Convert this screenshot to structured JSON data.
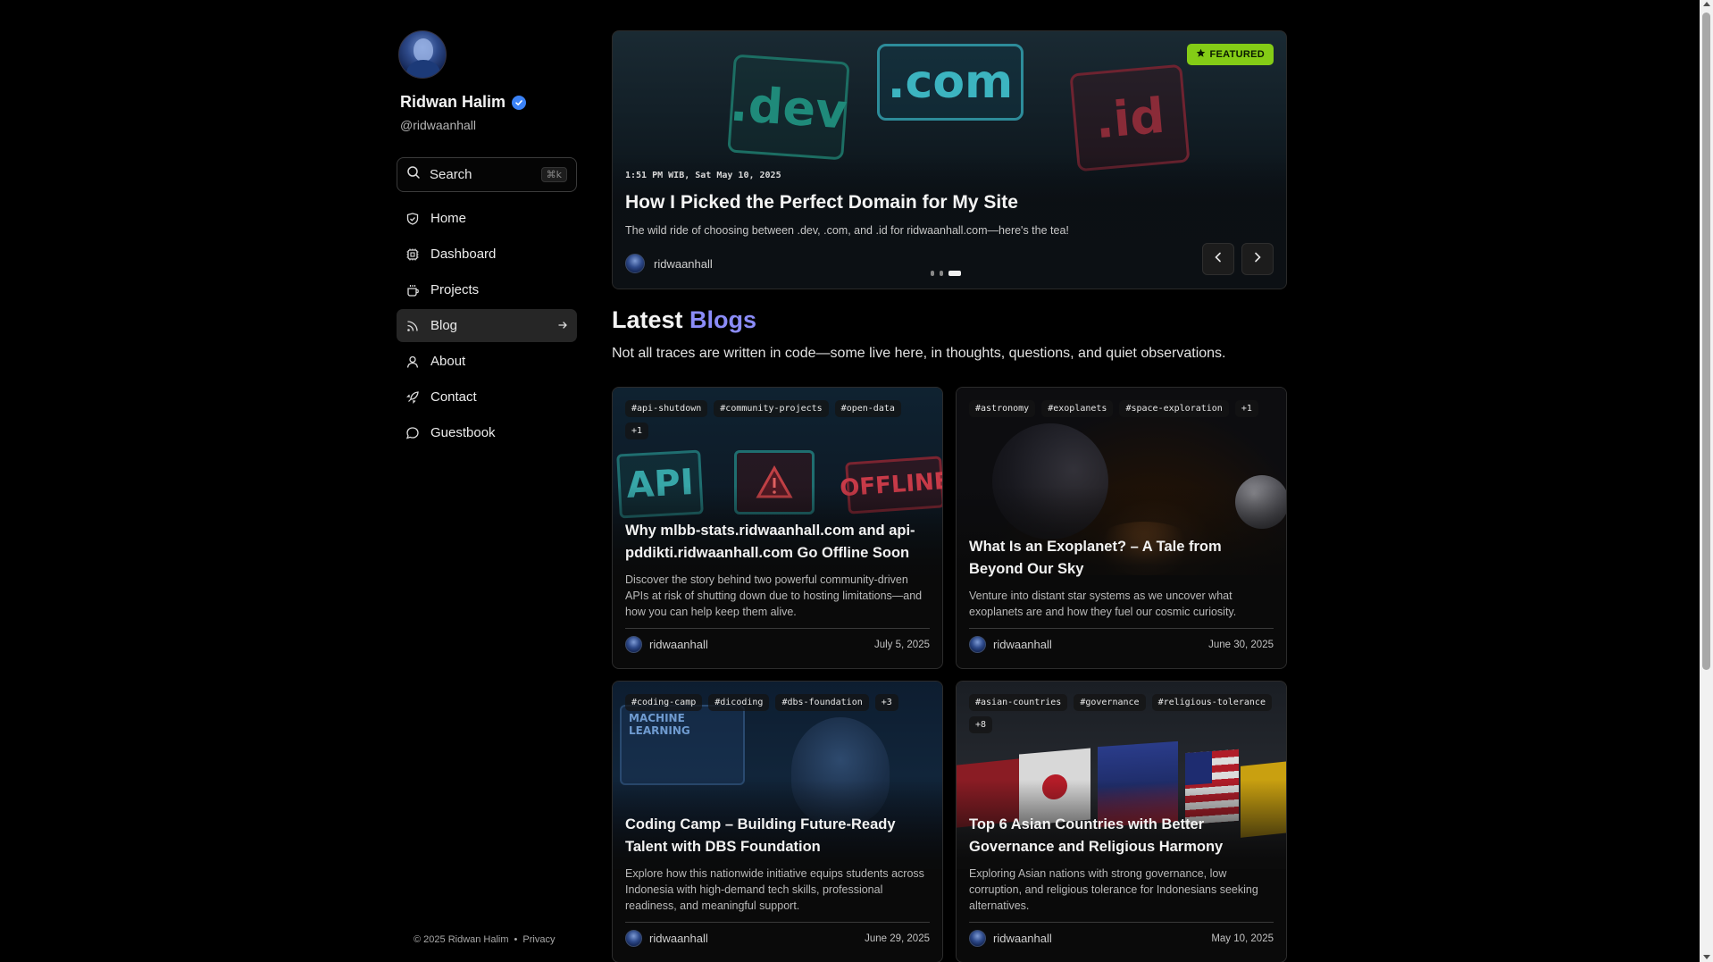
{
  "profile": {
    "name": "Ridwan Halim",
    "handle": "@ridwaanhall"
  },
  "search": {
    "label": "Search",
    "shortcut": "⌘k"
  },
  "nav": {
    "items": [
      {
        "label": "Home",
        "icon": "home-icon"
      },
      {
        "label": "Dashboard",
        "icon": "dashboard-icon"
      },
      {
        "label": "Projects",
        "icon": "projects-icon"
      },
      {
        "label": "Blog",
        "icon": "rss-icon",
        "active": true
      },
      {
        "label": "About",
        "icon": "user-icon"
      },
      {
        "label": "Contact",
        "icon": "rocket-icon"
      },
      {
        "label": "Guestbook",
        "icon": "chat-icon"
      }
    ]
  },
  "footer": {
    "copyright": "© 2025 Ridwan Halim",
    "separator": "•",
    "privacy": "Privacy"
  },
  "hero": {
    "badge": "FEATURED",
    "image_text": [
      ".dev",
      ".com",
      ".id"
    ],
    "date": "1:51 PM WIB, Sat May 10, 2025",
    "title": "How I Picked the Perfect Domain for My Site",
    "description": "The wild ride of choosing between .dev, .com, and .id for ridwaanhall.com—here's the tea!",
    "author": "ridwaanhall",
    "slide_count": 3,
    "active_slide": 3
  },
  "section": {
    "title_plain": "Latest",
    "title_accent": "Blogs",
    "subtitle": "Not all traces are written in code—some live here, in thoughts, questions, and quiet observations."
  },
  "posts": [
    {
      "tags": [
        "#api-shutdown",
        "#community-projects",
        "#open-data",
        "+1"
      ],
      "image_text": [
        "API",
        "OFFLINE"
      ],
      "title": "Why mlbb-stats.ridwaanhall.com and api-pddikti.ridwaanhall.com Go Offline Soon",
      "description": "Discover the story behind two powerful community-driven APIs at risk of shutting down due to hosting limitations—and how you can help keep them alive.",
      "author": "ridwaanhall",
      "date": "July 5, 2025"
    },
    {
      "tags": [
        "#astronomy",
        "#exoplanets",
        "#space-exploration",
        "+1"
      ],
      "title": "What Is an Exoplanet? – A Tale from Beyond Our Sky",
      "description": "Venture into distant star systems as we uncover what exoplanets are and how they fuel our cosmic curiosity.",
      "author": "ridwaanhall",
      "date": "June 30, 2025"
    },
    {
      "tags": [
        "#coding-camp",
        "#dicoding",
        "#dbs-foundation",
        "+3"
      ],
      "image_text": [
        "MACHINE LEARNING"
      ],
      "title": "Coding Camp – Building Future-Ready Talent with DBS Foundation",
      "description": "Explore how this nationwide initiative equips students across Indonesia with high-demand tech skills, professional readiness, and meaningful support.",
      "author": "ridwaanhall",
      "date": "June 29, 2025"
    },
    {
      "tags": [
        "#asian-countries",
        "#governance",
        "#religious-tolerance",
        "+8"
      ],
      "title": "Top 6 Asian Countries with Better Governance and Religious Harmony",
      "description": "Exploring Asian nations with strong governance, low corruption, and religious tolerance for Indonesians seeking alternatives.",
      "author": "ridwaanhall",
      "date": "May 10, 2025"
    }
  ],
  "colors": {
    "accent": "#8b8cf8",
    "featured": "#84cc16",
    "verified": "#3b82f6"
  }
}
